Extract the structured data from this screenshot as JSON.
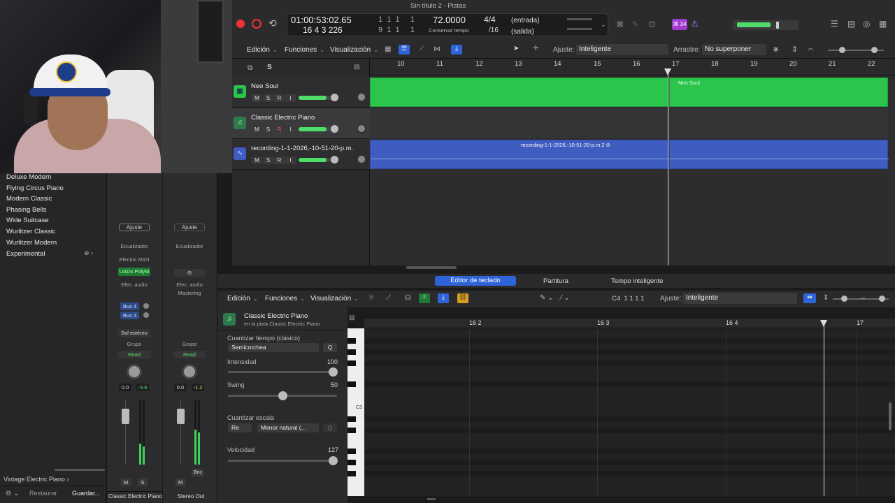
{
  "window": {
    "title": "Sin título 2 - Pistas"
  },
  "lcd": {
    "time": "01:00:53:02.65",
    "bars_top": "1  1  1     1",
    "bars_bottom_main": "16 4 3 226",
    "bars_bottom": "9  1  1     1",
    "tempo": "72.0000",
    "tempo_label": "Conservar tempo",
    "sig": "4/4",
    "sig_div": "/16",
    "in": "(entrada)",
    "out": "(salida)",
    "badge": "⌘ 34"
  },
  "toolbar": {
    "edit": "Edición",
    "functions": "Funciones",
    "view": "Visualización",
    "snap_label": "Ajuste:",
    "snap_value": "Inteligente",
    "drag_label": "Arrastre:",
    "drag_value": "No superponer"
  },
  "library": {
    "items": [
      "Deluxe Modern",
      "Flying Circus Piano",
      "Modern Classic",
      "Phasing Bells",
      "Wide Suitcase",
      "Wurlitzer Classic",
      "Wurlitzer Modern",
      "Experimental"
    ],
    "footer_preset": "Vintage Electric Piano",
    "restore": "Restaurar",
    "save": "Guardar..."
  },
  "mixer": {
    "strip1": {
      "ajuste": "Ajuste",
      "eq": "Ecualizador",
      "midi": "Efectos MIDI",
      "plugin": "UADx PolyM",
      "audio_fx": "Efec. audio",
      "bus1": "Bus 4",
      "bus2": "Bus 3",
      "output": "Sal estéreo",
      "group": "Grupo",
      "auto": "Read",
      "pan": "0.0",
      "level": "-3.6",
      "m": "M",
      "s": "S",
      "name": "Classic Electric Piano"
    },
    "strip2": {
      "ajuste": "Ajuste",
      "eq": "Ecualizador",
      "audio_fx": "Efec. audio",
      "mastering": "Mastering",
      "group": "Grupo",
      "auto": "Read",
      "pan": "0.0",
      "level": "-1.2",
      "m": "M",
      "bnc": "Bnc",
      "name": "Stereo Out"
    }
  },
  "tracks": [
    {
      "name": "Neo Soul",
      "type": "drum",
      "color": "#2bc54c"
    },
    {
      "name": "Classic Electric Piano",
      "type": "inst",
      "color": "#2bc54c"
    },
    {
      "name": "recording-1-1-2026,-10-51-20-p.m.",
      "type": "audio",
      "color": "#3f5cc0"
    }
  ],
  "track_buttons": {
    "m": "M",
    "s": "S",
    "r": "R",
    "i": "I"
  },
  "header_btn_s": "S",
  "ruler": [
    "10",
    "11",
    "12",
    "13",
    "14",
    "15",
    "16",
    "17",
    "18",
    "19",
    "20",
    "21",
    "22"
  ],
  "regions": {
    "neo_soul": "Neo Soul",
    "recording": "recording-1-1-2026,-10-51-20-p.m.2"
  },
  "editor": {
    "tabs": [
      "Editor de teclado",
      "Partitura",
      "Tempo inteligente"
    ],
    "edit": "Edición",
    "functions": "Funciones",
    "view": "Visualización",
    "position": "C4  1 1 1 1",
    "snap_label": "Ajuste:",
    "snap_value": "Inteligente",
    "region_name": "Classic Electric Piano",
    "region_sub": "en la pista Classic Electric Piano",
    "quant_label": "Cuantizar tiempo (clásico)",
    "quant_value": "Semicorchea",
    "q": "Q",
    "strength_label": "Intensidad",
    "strength_value": "100",
    "swing_label": "Swing",
    "swing_value": "50",
    "scale_label": "Cuantizar escala",
    "scale_root": "Re",
    "scale_type": "Menor natural (...",
    "velocity_label": "Velocidad",
    "velocity_value": "127",
    "c3": "C3",
    "ruler": [
      "16 2",
      "16 3",
      "16 4",
      "17"
    ]
  }
}
